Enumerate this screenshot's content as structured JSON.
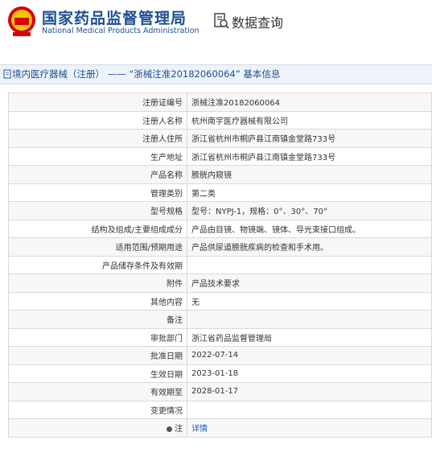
{
  "header": {
    "site_name_cn": "国家药品监督管理局",
    "site_name_en": "National Medical Products Administration",
    "db_title": "数据查询",
    "emblem_icon": "national-emblem-icon",
    "db_icon": "document-search-icon"
  },
  "breadcrumb": {
    "text": "境内医疗器械（注册） —— “浙械注准20182060064” 基本信息"
  },
  "rows": [
    {
      "label": "注册证编号",
      "value": "浙械注准20182060064"
    },
    {
      "label": "注册人名称",
      "value": "杭州南宇医疗器械有限公司"
    },
    {
      "label": "注册人住所",
      "value": "浙江省杭州市桐庐县江南镇金堂路733号"
    },
    {
      "label": "生产地址",
      "value": "浙江省杭州市桐庐县江南镇金堂路733号"
    },
    {
      "label": "产品名称",
      "value": "膀胱内窥镜"
    },
    {
      "label": "管理类别",
      "value": "第二类"
    },
    {
      "label": "型号规格",
      "value": "型号：NYPJ-1，规格：0°、30°、70°"
    },
    {
      "label": "结构及组成/主要组成成分",
      "value": "产品由目镜、物镜端、镜体、导光束接口组成。"
    },
    {
      "label": "适用范围/预期用途",
      "value": "产品供尿道膀胱疾病的检查和手术用。"
    },
    {
      "label": "产品储存条件及有效期",
      "value": ""
    },
    {
      "label": "附件",
      "value": "产品技术要求"
    },
    {
      "label": "其他内容",
      "value": "无"
    },
    {
      "label": "备注",
      "value": ""
    },
    {
      "label": "审批部门",
      "value": "浙江省药品监督管理局"
    },
    {
      "label": "批准日期",
      "value": "2022-07-14"
    },
    {
      "label": "生效日期",
      "value": "2023-01-18"
    },
    {
      "label": "有效期至",
      "value": "2028-01-17"
    },
    {
      "label": "变更情况",
      "value": ""
    },
    {
      "label": "注",
      "value": "详情"
    }
  ],
  "colors": {
    "brand_blue": "#1d4f91",
    "link_blue": "#2060b0",
    "emblem_red": "#d7000f"
  }
}
